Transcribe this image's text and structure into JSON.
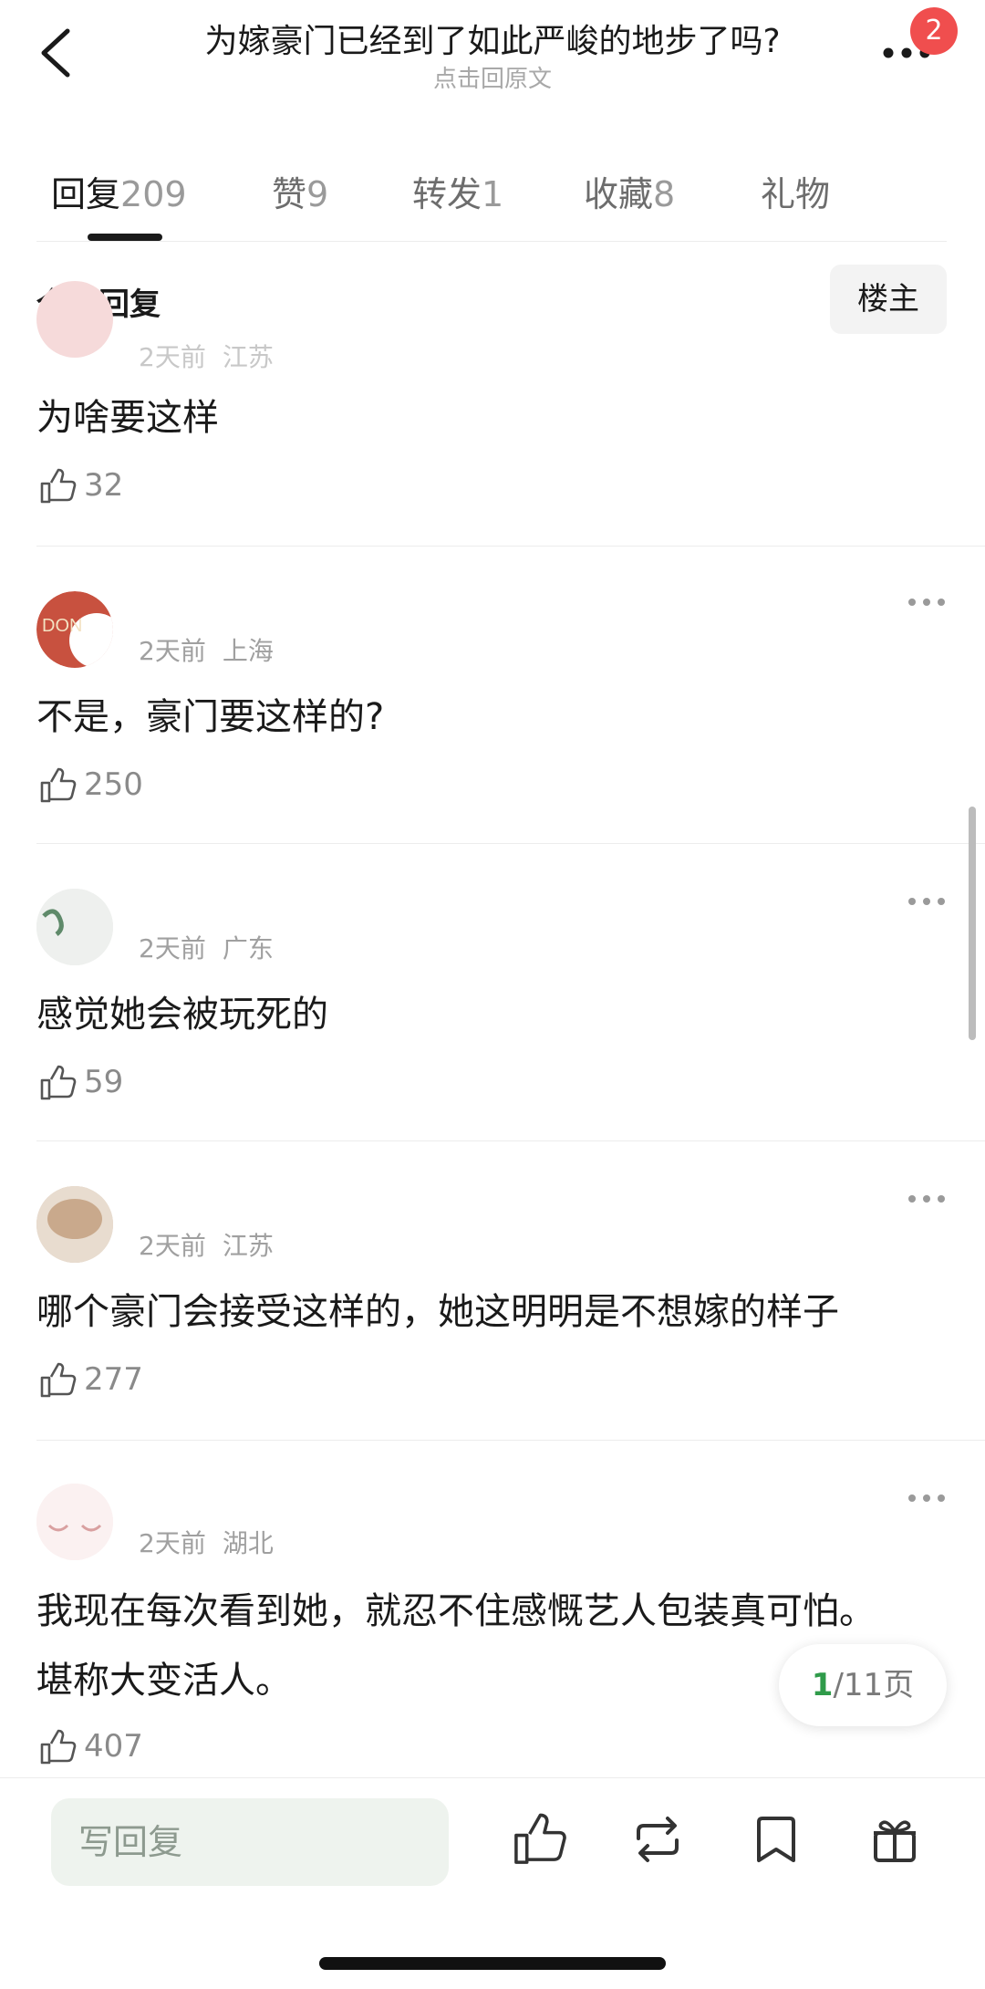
{
  "header": {
    "title": "为嫁豪门已经到了如此严峻的地步了吗?",
    "subtitle": "点击回原文",
    "badge": "2"
  },
  "tabs": [
    {
      "label": "回复",
      "count": "209"
    },
    {
      "label": "赞",
      "count": "9"
    },
    {
      "label": "转发",
      "count": "1"
    },
    {
      "label": "收藏",
      "count": "8"
    },
    {
      "label": "礼物",
      "count": ""
    }
  ],
  "filter": {
    "all_replies": "全部回复",
    "owner": "楼主"
  },
  "comments": [
    {
      "time": "2天前",
      "location": "江苏",
      "text": "为啥要这样",
      "likes": "32"
    },
    {
      "time": "2天前",
      "location": "上海",
      "text": "不是，豪门要这样的?",
      "likes": "250"
    },
    {
      "time": "2天前",
      "location": "广东",
      "text": "感觉她会被玩死的",
      "likes": "59"
    },
    {
      "time": "2天前",
      "location": "江苏",
      "text": "哪个豪门会接受这样的，她这明明是不想嫁的样子",
      "likes": "277"
    },
    {
      "time": "2天前",
      "location": "湖北",
      "text": "我现在每次看到她，就忍不住感慨艺人包装真可怕。堪称大变活人。",
      "likes": "407"
    }
  ],
  "pager": {
    "current": "1",
    "total": "/11页"
  },
  "bottom_bar": {
    "reply_placeholder": "写回复"
  },
  "colors": {
    "accent_green": "#2f9b4a",
    "badge_red": "#f04e4e"
  }
}
